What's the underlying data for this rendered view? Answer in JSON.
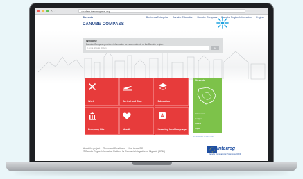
{
  "browser": {
    "url": "dc.danubecompass.org"
  },
  "topnav": {
    "language": "Slovenia",
    "links": [
      "Business/Enterprise",
      "Danube Education",
      "Danube Compass",
      "Danube Region Information",
      "English"
    ]
  },
  "brand": {
    "title": "DANUBE COMPASS"
  },
  "search": {
    "heading": "Welcome",
    "description": "Danube Compass provides information for new residents of the Danube region.",
    "placeholder": "I am a Slovak citizen",
    "button": "Go"
  },
  "tiles": [
    {
      "label": "Work",
      "icon": "tools-icon"
    },
    {
      "label": "Arrival and Stay",
      "icon": "airplane-icon"
    },
    {
      "label": "Education",
      "icon": "mortarboard-icon"
    },
    {
      "label": "Everyday Life",
      "icon": "building-icon"
    },
    {
      "label": "Health",
      "icon": "heart-icon"
    },
    {
      "label": "Learning local language",
      "icon": "letter-a-icon"
    }
  ],
  "map_panel": {
    "title": "Slovenia",
    "lines": [
      "Latest news",
      "Ljubljana",
      "Maribor",
      "Koper"
    ],
    "link": "Useful links in Slovenia"
  },
  "footer": {
    "links": [
      "About the project",
      "Terms and Conditions",
      "How to use DC"
    ],
    "copyright": "© Danube Region Information Platform for Economic Integration of Migrants (DRIM)"
  },
  "interreg": {
    "name": "Interreg",
    "subtitle": "Danube Transnational Programme",
    "project": "DRIM"
  },
  "colors": {
    "tiles": "#e73b3b",
    "map": "#7dc24a",
    "brand": "#2a4c8a"
  }
}
